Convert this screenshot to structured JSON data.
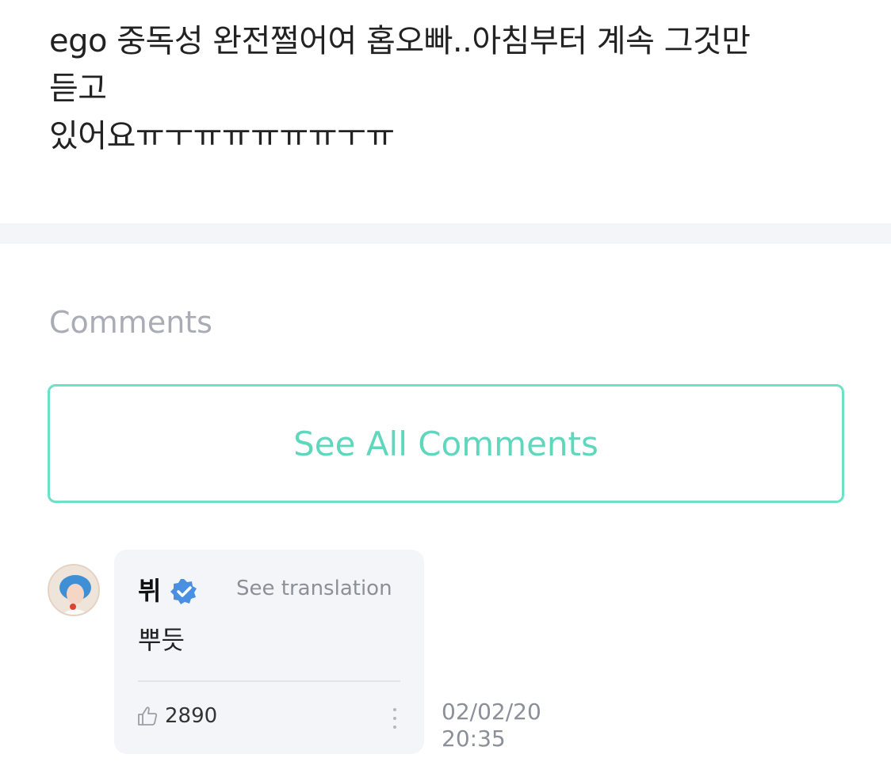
{
  "post": {
    "lines": [
      "ego 중독성 완전쩔어여 홉오빠..아침부터 계속 그것만",
      "듣고",
      "있어요ㅠㅜㅠㅠㅠㅠㅠㅜㅠ"
    ]
  },
  "comments_section": {
    "title": "Comments",
    "see_all_label": "See All Comments"
  },
  "comment": {
    "author": "뷔",
    "verified_icon": "verified-badge-icon",
    "translate_label": "See translation",
    "text": "뿌듯",
    "like_icon": "thumbs-up-icon",
    "like_count": "2890",
    "more_icon": "more-vertical-icon",
    "date": "02/02/20",
    "time": "20:35"
  },
  "colors": {
    "accent": "#5fd7bc",
    "verified": "#4a90e2",
    "muted": "#8b8f97",
    "band": "#f4f5f8"
  }
}
